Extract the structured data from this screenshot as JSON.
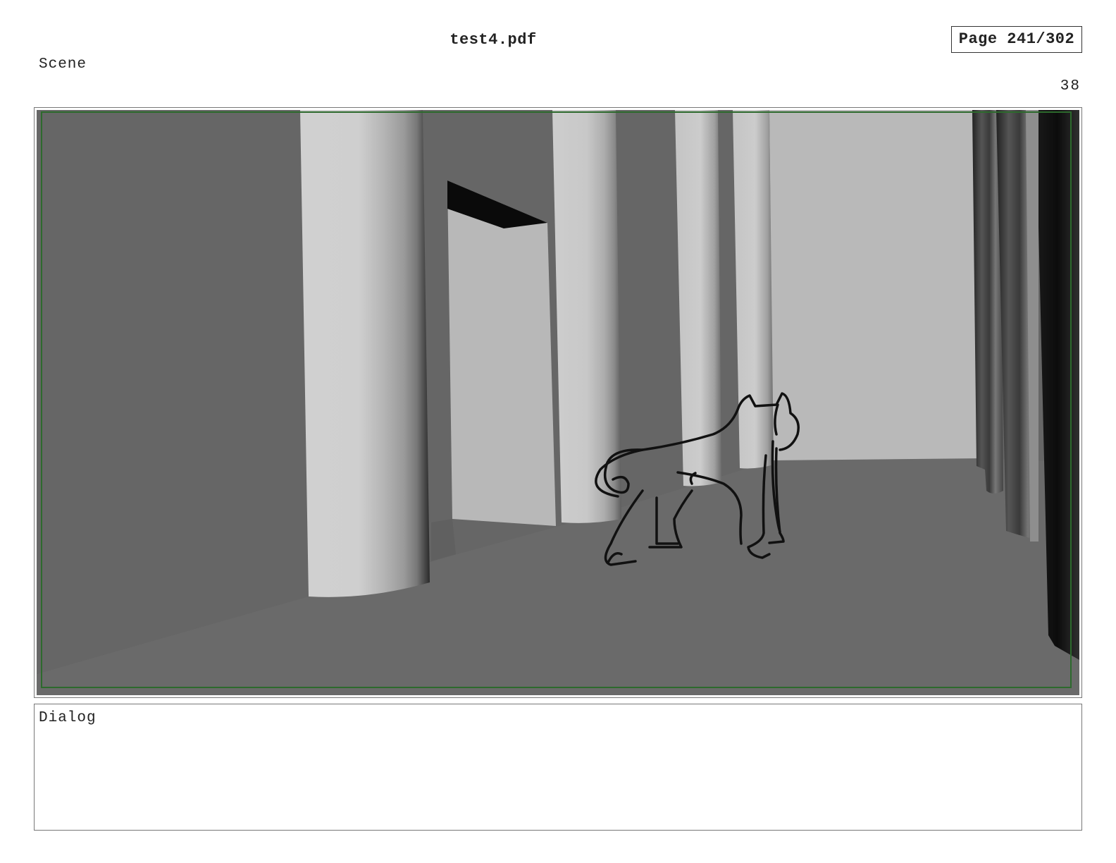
{
  "document": {
    "title": "test4.pdf",
    "page_indicator": "Page 241/302"
  },
  "panel": {
    "scene_label": "Scene",
    "number": "38",
    "image": {
      "description_icon": "storyboard-frame-image",
      "colors": {
        "back_wall": "#666666",
        "floor": "#6a6a6a",
        "light_wall": "#b8b8b8",
        "column_light": "#d4d4d4",
        "safe_area_border": "#2d6a2d",
        "sketch_line": "#111111"
      }
    }
  },
  "dialog": {
    "label": "Dialog",
    "text": ""
  }
}
